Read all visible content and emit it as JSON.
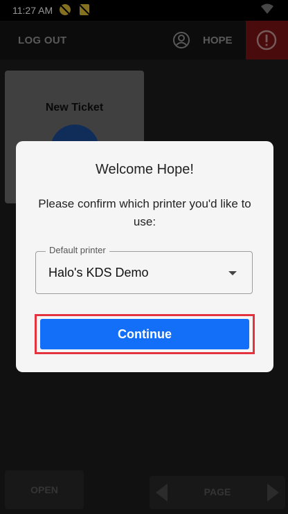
{
  "status_bar": {
    "time": "11:27 AM",
    "icons": [
      "dnd-off-icon",
      "no-sim-icon",
      "wifi-icon"
    ]
  },
  "app_bar": {
    "logout_label": "LOG OUT",
    "user_name": "HOPE",
    "user_icon": "account-circle-icon",
    "alert_icon": "alert-circle-icon",
    "alert_color": "#7e1414"
  },
  "tile": {
    "label": "New Ticket",
    "icon": "ticket-icon"
  },
  "bottom": {
    "open_label": "OPEN",
    "page_label": "PAGE",
    "prev_icon": "chevron-left-icon",
    "next_icon": "chevron-right-icon"
  },
  "dialog": {
    "title": "Welcome Hope!",
    "message": "Please confirm which printer you'd like to use:",
    "printer_label": "Default printer",
    "printer_value": "Halo's KDS Demo",
    "continue_label": "Continue",
    "accent": "#136ff7",
    "highlight": "#e5323f"
  }
}
